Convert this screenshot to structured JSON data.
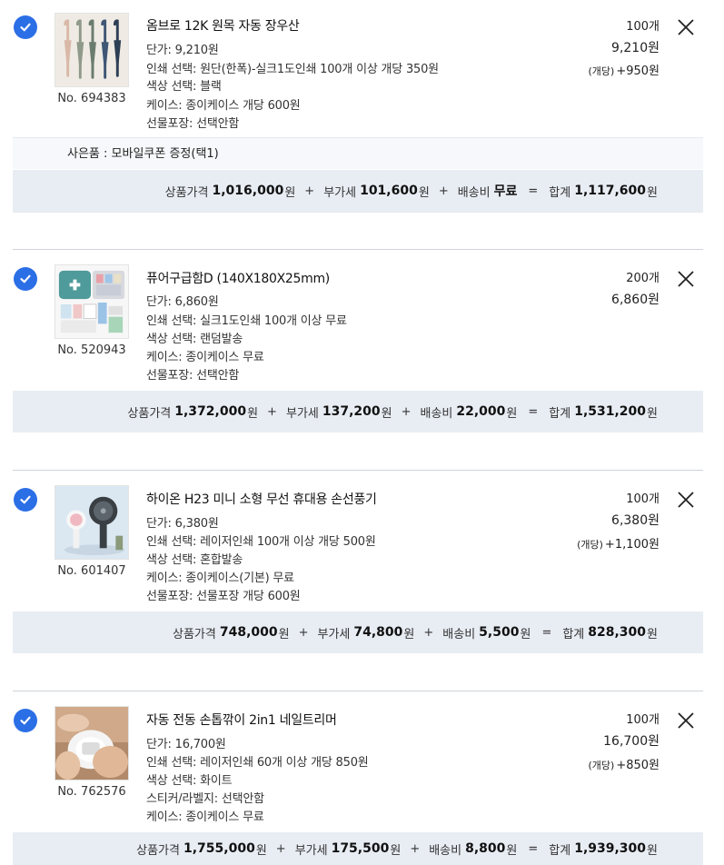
{
  "currency": "원",
  "items": [
    {
      "product_no": "No. 694383",
      "name": "옴브로 12K 원목 자동 장우산",
      "unit_price": "단가: 9,210원",
      "options": [
        "인쇄 선택: 원단(한폭)-실크1도인쇄 100개 이상 개당 350원",
        "색상 선택: 블랙",
        "케이스: 종이케이스 개당 600원",
        "선물포장: 선택안함"
      ],
      "qty": "100개",
      "price": "9,210원",
      "unit_add_label": "(개당)",
      "unit_add_value": "+950원",
      "gift": "사은품 : 모바일쿠폰 증정(택1)",
      "summary": {
        "goods_label": "상품가격",
        "goods": "1,016,000",
        "vat_label": "부가세",
        "vat": "101,600",
        "ship_label": "배송비",
        "ship": "무료",
        "total_label": "합계",
        "total": "1,117,600"
      }
    },
    {
      "product_no": "No. 520943",
      "name": "퓨어구급함D (140X180X25mm)",
      "unit_price": "단가: 6,860원",
      "options": [
        "인쇄 선택: 실크1도인쇄 100개 이상 무료",
        "색상 선택: 랜덤발송",
        "케이스: 종이케이스 무료",
        "선물포장: 선택안함"
      ],
      "qty": "200개",
      "price": "6,860원",
      "summary": {
        "goods_label": "상품가격",
        "goods": "1,372,000",
        "vat_label": "부가세",
        "vat": "137,200",
        "ship_label": "배송비",
        "ship": "22,000",
        "total_label": "합계",
        "total": "1,531,200"
      }
    },
    {
      "product_no": "No. 601407",
      "name": "하이온 H23 미니 소형 무선 휴대용 손선풍기",
      "unit_price": "단가: 6,380원",
      "options": [
        "인쇄 선택: 레이저인쇄 100개 이상 개당 500원",
        "색상 선택: 혼합발송",
        "케이스: 종이케이스(기본) 무료",
        "선물포장: 선물포장 개당 600원"
      ],
      "qty": "100개",
      "price": "6,380원",
      "unit_add_label": "(개당)",
      "unit_add_value": "+1,100원",
      "summary": {
        "goods_label": "상품가격",
        "goods": "748,000",
        "vat_label": "부가세",
        "vat": "74,800",
        "ship_label": "배송비",
        "ship": "5,500",
        "total_label": "합계",
        "total": "828,300"
      }
    },
    {
      "product_no": "No. 762576",
      "name": "자동 전동 손톱깎이 2in1 네일트리머",
      "unit_price": "단가: 16,700원",
      "options": [
        "인쇄 선택: 레이저인쇄 60개 이상 개당 850원",
        "색상 선택: 화이트",
        "스티커/라벨지: 선택안함",
        "케이스: 종이케이스 무료"
      ],
      "qty": "100개",
      "price": "16,700원",
      "unit_add_label": "(개당)",
      "unit_add_value": "+850원",
      "summary": {
        "goods_label": "상품가격",
        "goods": "1,755,000",
        "vat_label": "부가세",
        "vat": "175,500",
        "ship_label": "배송비",
        "ship": "8,800",
        "total_label": "합계",
        "total": "1,939,300"
      }
    }
  ],
  "colors": {
    "check": "#2b6fe6",
    "summary_bg": "#e8edf4",
    "gift_bg": "#f6f8fb",
    "divider": "#cfd3d8"
  }
}
